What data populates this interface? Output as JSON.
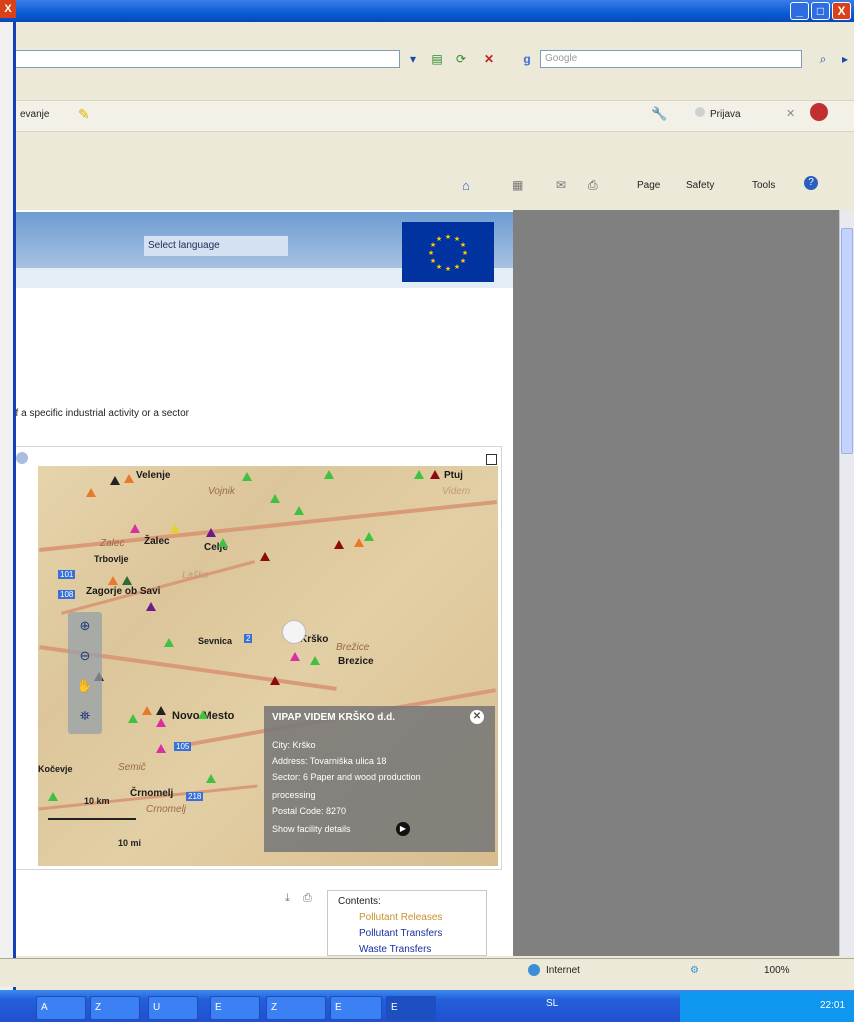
{
  "window": {
    "close_glyph": "X",
    "minimize_glyph": "_",
    "maximize_glyph": "□",
    "close_right_glyph": "X"
  },
  "addressbar": {
    "search_placeholder": "Google"
  },
  "linksbar": {
    "left_text": "evanje",
    "prijava_label": "Prijava"
  },
  "commandbar": {
    "page_label": "Page",
    "safety_label": "Safety",
    "tools_label": "Tools"
  },
  "site": {
    "select_language": "Select language",
    "intro_text": "of a specific industrial activity or a sector"
  },
  "map": {
    "cities": [
      "Velenje",
      "Vojnik",
      "Zalec",
      "Žalec",
      "Celje",
      "Trbovlje",
      "Zagorje ob Savi",
      "Sevnica",
      "Krško",
      "Brežice",
      "Brezice",
      "Novo Mesto",
      "Semič",
      "Črnomelj",
      "Crnomelj",
      "Ptuj",
      "Videm",
      "Kočevje",
      "Laško"
    ],
    "road_labels": [
      "101",
      "108",
      "2",
      "105",
      "218"
    ],
    "scale_km": "10 km",
    "scale_mi": "10 mi",
    "popup": {
      "title": "VIPAP VIDEM KRŠKO d.d.",
      "city": "City: Krško",
      "address": "Address: Tovarniška ulica 18",
      "sector": "Sector: 6 Paper and wood production",
      "sector_cont": "processing",
      "postal": "Postal Code: 8270",
      "details_link": "Show facility details"
    }
  },
  "contents": {
    "heading": "Contents:",
    "items": [
      "Pollutant Releases",
      "Pollutant Transfers",
      "Waste Transfers"
    ]
  },
  "statusbar": {
    "zone": "Internet",
    "zoom": "100%"
  },
  "taskbar": {
    "items": [
      "A",
      "Z",
      "U",
      "E",
      "Z",
      "E",
      "E"
    ],
    "lang": "SL",
    "clock": "22:01"
  },
  "colors": {
    "titlebar": "#0a5bd6",
    "eu_blue": "#0033a0",
    "eu_star": "#ffcc00",
    "pollutant_releases": "#c8922c",
    "pollutant_transfers": "#1a2fa0",
    "waste_transfers": "#1a2fa0"
  }
}
